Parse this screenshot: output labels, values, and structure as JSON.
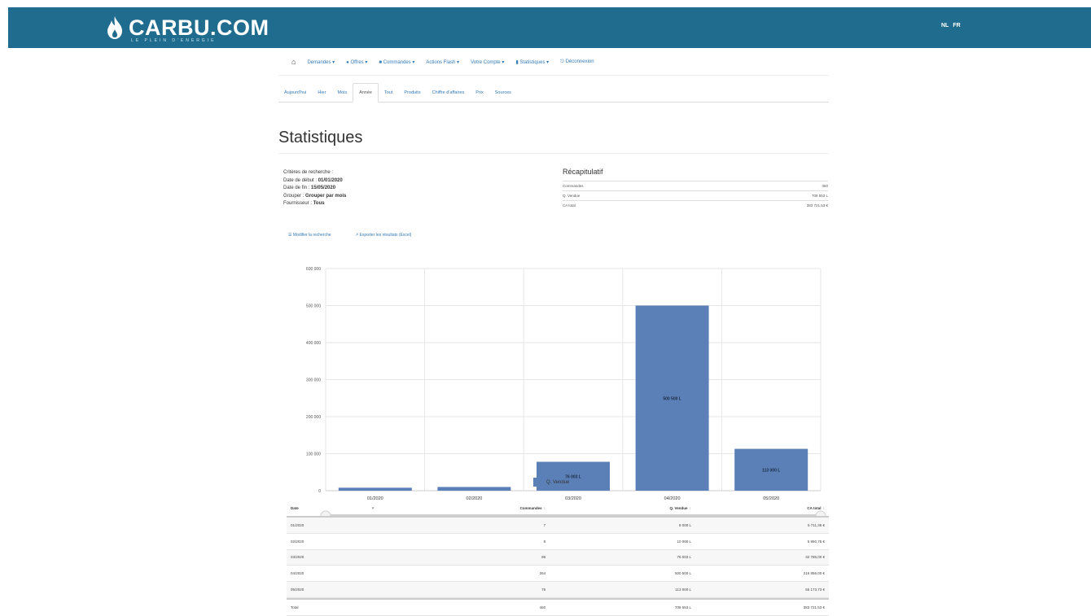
{
  "brand": {
    "name": "CARBU.COM",
    "tagline": "LE PLEIN D'ENERGIE"
  },
  "lang": {
    "nl": "NL",
    "fr": "FR"
  },
  "nav": {
    "items": [
      "Demandes",
      "Offres",
      "Commandes",
      "Actions Flash",
      "Votre Compte",
      "Statistiques",
      "Déconnexion"
    ]
  },
  "tabs": [
    "Aujourd'hui",
    "Hier",
    "Mois",
    "Année",
    "Tout",
    "Produits",
    "Chiffre d'affaires",
    "Prix",
    "Sources"
  ],
  "active_tab_index": 3,
  "page_title": "Statistiques",
  "criteria": {
    "heading": "Critères de recherche :",
    "start_label": "Date de début :",
    "start_value": "01/01/2020",
    "end_label": "Date de fin :",
    "end_value": "15/05/2020",
    "group_label": "Grouper :",
    "group_value": "Grouper par mois",
    "supplier_label": "Fournisseur :",
    "supplier_value": "Tous"
  },
  "recap": {
    "title": "Récapitulatif",
    "rows": [
      {
        "label": "Commandes",
        "value": "460"
      },
      {
        "label": "Q. Vendue",
        "value": "708 553 L"
      },
      {
        "label": "CA total",
        "value": "383 721,53 €"
      }
    ]
  },
  "actions": {
    "modify": "Modifier la recherche",
    "export": "Exporter les résultats (Excel)"
  },
  "chart_data": {
    "type": "bar",
    "categories": [
      "01/2020",
      "02/2020",
      "03/2020",
      "04/2020",
      "05/2020"
    ],
    "series": [
      {
        "name": "Q. Vendue",
        "values": [
          8000,
          10000,
          78000,
          500000,
          113000
        ]
      }
    ],
    "data_labels": [
      "",
      "",
      "76 003 L",
      "500 500 L",
      "113 000 L"
    ],
    "ytick_labels": [
      "0",
      "100 000",
      "200 000",
      "300 000",
      "400 000",
      "500 000",
      "600 000"
    ],
    "ylim": [
      0,
      600000
    ],
    "grid": true,
    "color": "#5b80b8",
    "legend": "bottom"
  },
  "table": {
    "headers": [
      "Date",
      "Commandes",
      "Q. Vendue",
      "CA total"
    ],
    "rows": [
      [
        "01/2020",
        "7",
        "8 000 L",
        "5 711,36 €"
      ],
      [
        "02/2020",
        "8",
        "10 000 L",
        "5 860,75 €"
      ],
      [
        "03/2020",
        "96",
        "76 003 L",
        "32 785,00 €"
      ],
      [
        "04/2020",
        "264",
        "500 500 L",
        "216 856,00 €"
      ],
      [
        "05/2020",
        "76",
        "113 000 L",
        "55 173,73 €"
      ],
      [
        "Total",
        "460",
        "708 553 L",
        "383 721,53 €"
      ]
    ]
  }
}
